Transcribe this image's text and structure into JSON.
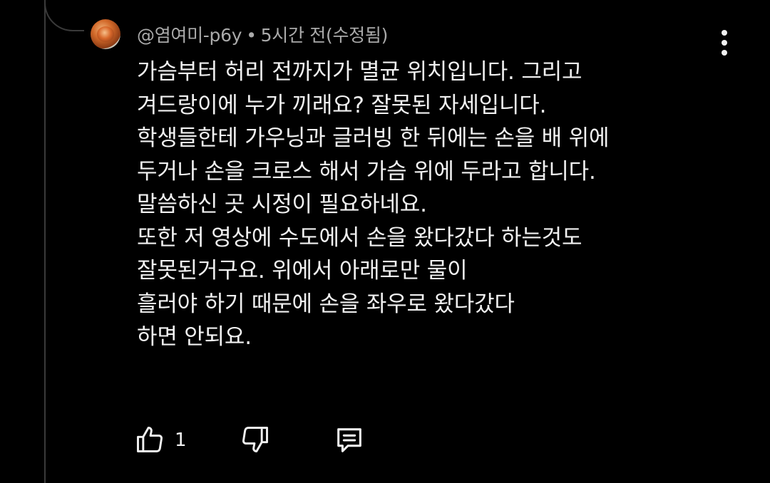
{
  "comment": {
    "author": "@염여미-p6y",
    "separator": "•",
    "timestamp": "5시간 전(수정됨)",
    "lines": [
      "가슴부터 허리 전까지가 멸균 위치입니다. 그리고",
      "겨드랑이에 누가 끼래요? 잘못된 자세입니다.",
      "학생들한테 가우닝과 글러빙 한 뒤에는 손을 배 위에",
      "두거나 손을 크로스 해서 가슴 위에 두라고 합니다.",
      "말씀하신 곳 시정이 필요하네요.",
      "또한 저 영상에 수도에서 손을 왔다갔다 하는것도",
      "잘못된거구요. 위에서 아래로만 물이",
      "흘러야 하기 때문에 손을 좌우로 왔다갔다",
      "하면 안되요."
    ],
    "like_count": "1"
  },
  "icons": {
    "more": "more-vert-icon",
    "like": "thumbs-up-icon",
    "dislike": "thumbs-down-icon",
    "reply": "comment-reply-icon"
  },
  "colors": {
    "background": "#000000",
    "text": "#f1f1f1",
    "meta_text": "#aaaaaa",
    "thread_line": "#3a3a3a"
  }
}
